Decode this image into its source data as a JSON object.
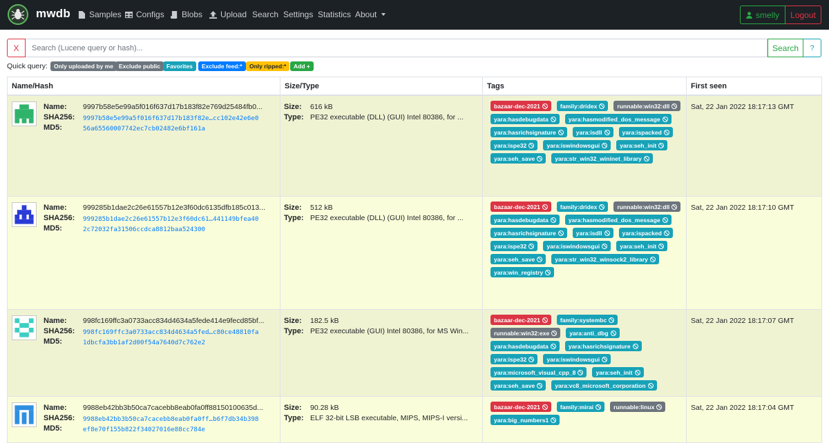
{
  "navbar": {
    "brand": "mwdb",
    "items": [
      {
        "label": "Samples",
        "icon": "file-icon"
      },
      {
        "label": "Configs",
        "icon": "table-icon"
      },
      {
        "label": "Blobs",
        "icon": "scroll-icon"
      },
      {
        "label": "Upload",
        "icon": "upload-icon"
      },
      {
        "label": "Search"
      },
      {
        "label": "Settings"
      },
      {
        "label": "Statistics"
      },
      {
        "label": "About"
      }
    ],
    "user": "smelly",
    "logout": "Logout"
  },
  "search": {
    "clear_label": "X",
    "placeholder": "Search (Lucene query or hash)...",
    "search_label": "Search",
    "help_label": "?"
  },
  "quick_query": {
    "label": "Quick query:",
    "items": [
      "Only uploaded by me",
      "Exclude public",
      "Favorites",
      "Exclude feed:*",
      "Only ripped:*",
      "Add +"
    ]
  },
  "table": {
    "headers": [
      "Name/Hash",
      "Size/Type",
      "Tags",
      "First seen"
    ],
    "key_labels": {
      "name": "Name:",
      "sha256": "SHA256:",
      "md5": "MD5:",
      "size": "Size:",
      "type": "Type:"
    },
    "rows": [
      {
        "name": "9997b58e5e99a5f016f637d17b183f82e769d25484fb0...",
        "sha256": "9997b58e5e99a5f016f637d17b183f82e…cc102e42e6e0",
        "md5": "56a65560007742ec7cb02482e6bf161a",
        "size": "616 kB",
        "type": "PE32 executable (DLL) (GUI) Intel 80386, for ...",
        "first_seen": "Sat, 22 Jan 2022 18:17:13 GMT",
        "tags": [
          {
            "label": "bazaar-dec-2021",
            "color": "red"
          },
          {
            "label": "family:dridex",
            "color": "teal"
          },
          {
            "label": "runnable:win32:dll",
            "color": "gray"
          },
          {
            "label": "yara:hasdebugdata",
            "color": "teal"
          },
          {
            "label": "yara:hasmodified_dos_message",
            "color": "teal"
          },
          {
            "label": "yara:hasrichsignature",
            "color": "teal"
          },
          {
            "label": "yara:isdll",
            "color": "teal"
          },
          {
            "label": "yara:ispacked",
            "color": "teal"
          },
          {
            "label": "yara:ispe32",
            "color": "teal"
          },
          {
            "label": "yara:iswindowsgui",
            "color": "teal"
          },
          {
            "label": "yara:seh_init",
            "color": "teal"
          },
          {
            "label": "yara:seh_save",
            "color": "teal"
          },
          {
            "label": "yara:str_win32_wininet_library",
            "color": "teal"
          }
        ]
      },
      {
        "name": "999285b1dae2c26e61557b12e3f60dc6135dfb185c013...",
        "sha256": "999285b1dae2c26e61557b12e3f60dc61…441149bfea40",
        "md5": "2c72032fa31506ccdca8812baa524300",
        "size": "512 kB",
        "type": "PE32 executable (DLL) (GUI) Intel 80386, for ...",
        "first_seen": "Sat, 22 Jan 2022 18:17:10 GMT",
        "tags": [
          {
            "label": "bazaar-dec-2021",
            "color": "red"
          },
          {
            "label": "family:dridex",
            "color": "teal"
          },
          {
            "label": "runnable:win32:dll",
            "color": "gray"
          },
          {
            "label": "yara:hasdebugdata",
            "color": "teal"
          },
          {
            "label": "yara:hasmodified_dos_message",
            "color": "teal"
          },
          {
            "label": "yara:hasrichsignature",
            "color": "teal"
          },
          {
            "label": "yara:isdll",
            "color": "teal"
          },
          {
            "label": "yara:ispacked",
            "color": "teal"
          },
          {
            "label": "yara:ispe32",
            "color": "teal"
          },
          {
            "label": "yara:iswindowsgui",
            "color": "teal"
          },
          {
            "label": "yara:seh_init",
            "color": "teal"
          },
          {
            "label": "yara:seh_save",
            "color": "teal"
          },
          {
            "label": "yara:str_win32_winsock2_library",
            "color": "teal"
          },
          {
            "label": "yara:win_registry",
            "color": "teal"
          }
        ]
      },
      {
        "name": "998fc169ffc3a0733acc834d4634a5fede414e9fecd85bf...",
        "sha256": "998fc169ffc3a0733acc834d4634a5fed…c80ce48810fa",
        "md5": "1dbcfa3bb1af2d00f54a7640d7c762e2",
        "size": "182.5 kB",
        "type": "PE32 executable (GUI) Intel 80386, for MS Win...",
        "first_seen": "Sat, 22 Jan 2022 18:17:07 GMT",
        "tags": [
          {
            "label": "bazaar-dec-2021",
            "color": "red"
          },
          {
            "label": "family:systembc",
            "color": "teal"
          },
          {
            "label": "runnable:win32:exe",
            "color": "gray"
          },
          {
            "label": "yara:anti_dbg",
            "color": "teal"
          },
          {
            "label": "yara:hasdebugdata",
            "color": "teal"
          },
          {
            "label": "yara:hasrichsignature",
            "color": "teal"
          },
          {
            "label": "yara:ispe32",
            "color": "teal"
          },
          {
            "label": "yara:iswindowsgui",
            "color": "teal"
          },
          {
            "label": "yara:microsoft_visual_cpp_8",
            "color": "teal"
          },
          {
            "label": "yara:seh_init",
            "color": "teal"
          },
          {
            "label": "yara:seh_save",
            "color": "teal"
          },
          {
            "label": "yara:vc8_microsoft_corporation",
            "color": "teal"
          }
        ]
      },
      {
        "name": "9988eb42bb3b50ca7cacebb8eab0fa0ff88150100635d...",
        "sha256": "9988eb42bb3b50ca7cacebb8eab0fa0ff…b6f7db34b398",
        "md5": "ef8e70f155b822f34027016e88cc784e",
        "size": "90.28 kB",
        "type": "ELF 32-bit LSB executable, MIPS, MIPS-I versi...",
        "first_seen": "Sat, 22 Jan 2022 18:17:04 GMT",
        "tags": [
          {
            "label": "bazaar-dec-2021",
            "color": "red"
          },
          {
            "label": "family:mirai",
            "color": "teal"
          },
          {
            "label": "runnable:linux",
            "color": "gray"
          },
          {
            "label": "yara:big_numbers1",
            "color": "teal"
          }
        ]
      }
    ]
  }
}
